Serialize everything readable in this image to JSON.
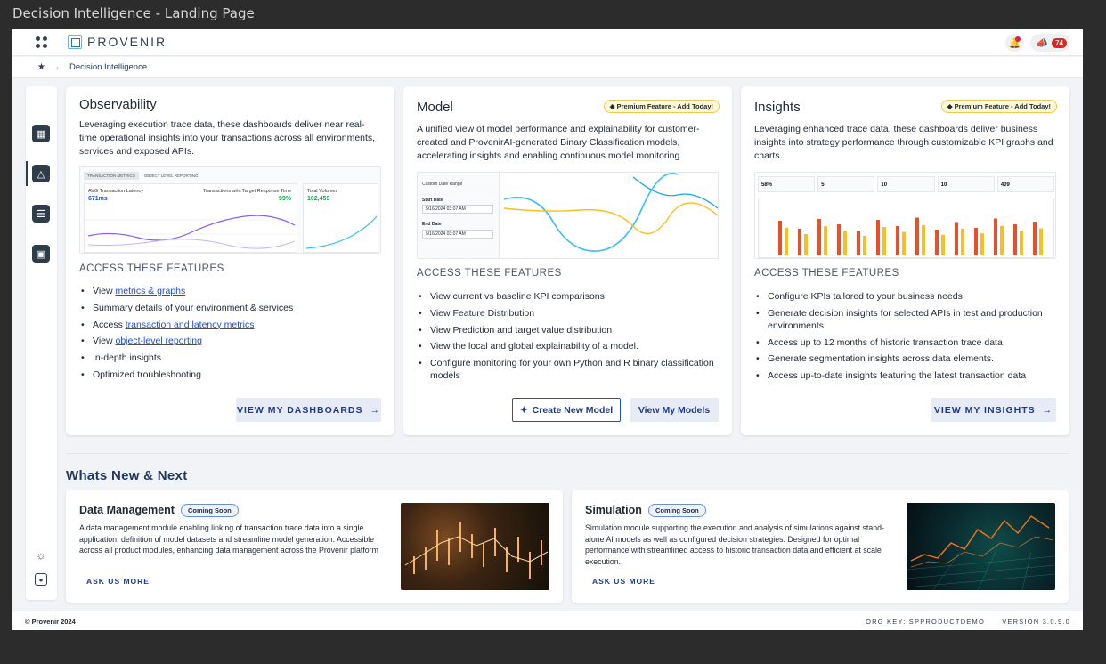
{
  "window": {
    "title": "Decision Intelligence - Landing Page"
  },
  "topbar": {
    "logo_text": "PROVENIR",
    "notification_count": "74"
  },
  "breadcrumb": {
    "item": "Decision Intelligence"
  },
  "cards": [
    {
      "title": "Observability",
      "description": "Leveraging execution trace data, these dashboards deliver near real-time operational insights into your transactions across all environments, services and exposed APIs.",
      "access_label": "ACCESS THESE FEATURES",
      "features": [
        {
          "pre": "View ",
          "link": "metrics & graphs",
          "post": ""
        },
        {
          "pre": "Summary details of your environment & services",
          "link": "",
          "post": ""
        },
        {
          "pre": "Access ",
          "link": "transaction and latency metrics",
          "post": ""
        },
        {
          "pre": "View ",
          "link": "object-level reporting",
          "post": ""
        },
        {
          "pre": "In-depth insights",
          "link": "",
          "post": ""
        },
        {
          "pre": "Optimized troubleshooting",
          "link": "",
          "post": ""
        }
      ],
      "button": "VIEW MY DASHBOARDS",
      "preview": {
        "tabs": [
          "TRANSACTION METRICS",
          "OBJECT LEVEL REPORTING"
        ],
        "m1_label": "AVG Transaction Latency",
        "m1_value": "671ms",
        "m2_label": "Transactions w/in Target Response Time",
        "m2_value": "99%",
        "m3_label": "Total Volumes",
        "m3_value": "102,459"
      }
    },
    {
      "title": "Model",
      "premium": "Premium Feature - Add Today!",
      "description": "A unified view of model performance and explainability for customer-created and ProvenirAI-generated Binary Classification models, accelerating insights and enabling continuous model monitoring.",
      "access_label": "ACCESS THESE FEATURES",
      "features": [
        "View current vs baseline KPI comparisons",
        "View Feature Distribution",
        "View Prediction and target value distribution",
        "View the local and global explainability of a model.",
        "Configure monitoring for your own Python and R binary classification models"
      ],
      "button_create": "Create New Model",
      "button_view": "View My Models",
      "preview": {
        "range_label": "Custom Date Range",
        "start_label": "Start Date",
        "start_value": "5/16/2024  03:07 AM",
        "end_label": "End Date",
        "end_value": "5/16/2024  03:07 AM"
      }
    },
    {
      "title": "Insights",
      "premium": "Premium Feature - Add Today!",
      "description": "Leveraging enhanced trace data, these dashboards deliver business insights into strategy performance through customizable KPI graphs and charts.",
      "access_label": "ACCESS THESE FEATURES",
      "features": [
        "Configure KPIs tailored to your business needs",
        "Generate decision insights for selected APIs in test and production environments",
        "Access up to 12 months of historic transaction trace data",
        "Generate segmentation insights across data elements.",
        "Access up-to-date insights featuring the latest transaction data"
      ],
      "button": "VIEW MY INSIGHTS",
      "preview": {
        "kpis": [
          "58%",
          "5",
          "10",
          "10",
          "409"
        ]
      }
    }
  ],
  "whats_new": {
    "heading": "Whats New & Next",
    "items": [
      {
        "title": "Data Management",
        "badge": "Coming Soon",
        "description": "A data management module enabling linking of transaction trace data into a single application, definition of model datasets and streamline model generation. Accessible across all product modules, enhancing data management across the Provenir platform",
        "cta": "ASK US MORE"
      },
      {
        "title": "Simulation",
        "badge": "Coming Soon",
        "description": "Simulation module supporting the execution and analysis of simulations against stand-alone AI models as well as configured decision strategies. Designed for optimal performance with streamlined access to historic transaction data and efficient at scale execution.",
        "cta": "ASK US MORE"
      }
    ]
  },
  "footer": {
    "copyright": "© Provenir 2024",
    "org_key": "ORG KEY: SPPRODUCTDEMO",
    "version": "VERSION 3.0.9.0"
  },
  "colors": {
    "accent": "#1e3a8a",
    "premium_bg": "#fff8d6",
    "chart_red": "#e8502b",
    "chart_yellow": "#f5c026"
  }
}
